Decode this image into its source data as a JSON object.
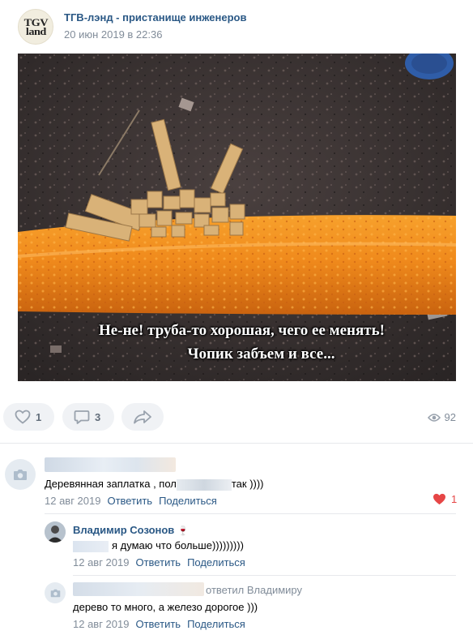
{
  "post": {
    "group_name": "ТГВ-лэнд - пристанище инженеров",
    "avatar_text": "TGV\nland",
    "date": "20 июн 2019 в 22:36",
    "image_caption_line1": "Не-не! труба-то хорошая, чего ее менять!",
    "image_caption_line2": "Чопик забъем и все..."
  },
  "actions": {
    "likes": "1",
    "comments": "3",
    "views": "92",
    "icons": [
      "heart-icon",
      "comment-icon",
      "share-icon",
      "eye-icon"
    ]
  },
  "comments": [
    {
      "text_visible_start": "Деревянная заплатка , пол",
      "text_visible_end": "так ))))",
      "date": "12 авг 2019",
      "reply_label": "Ответить",
      "share_label": "Поделиться",
      "likes": "1"
    },
    {
      "author": "Владимир Созонов",
      "author_emoji": "🍷",
      "text": "я думаю что больше)))))))))",
      "date": "12 авг 2019",
      "reply_label": "Ответить",
      "share_label": "Поделиться"
    },
    {
      "reply_to": "ответил Владимиру",
      "text": "дерево то много, а железо дорогое )))",
      "date": "12 авг 2019",
      "reply_label": "Ответить",
      "share_label": "Поделиться"
    }
  ],
  "colors": {
    "link": "#2a5885",
    "muted": "#818c99",
    "button_bg": "#f0f2f5",
    "liked_heart": "#e64646",
    "pipe_orange": "#f08a1c"
  }
}
